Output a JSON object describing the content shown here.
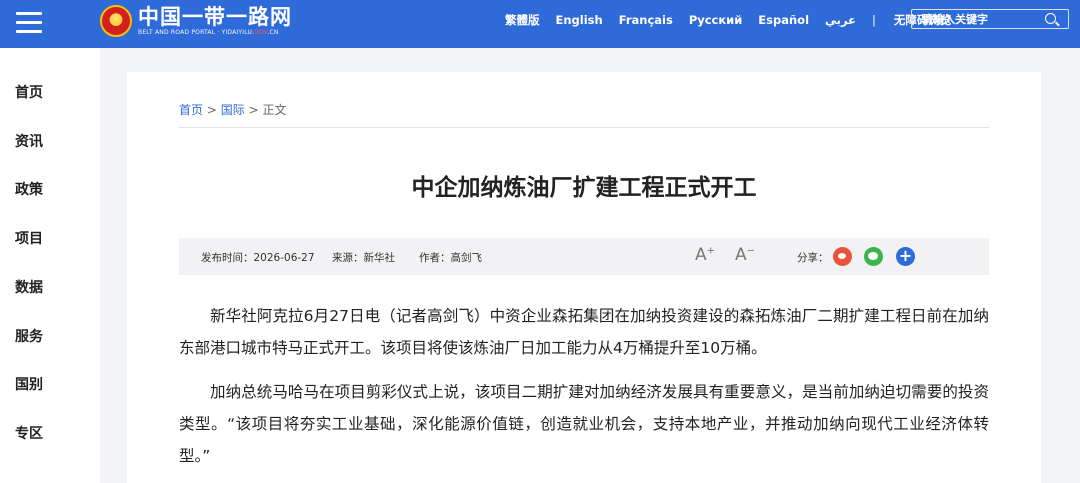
{
  "header": {
    "logo_cn": "中国一带一路网",
    "logo_en_prefix": "BELT AND ROAD PORTAL · YIDAIYILU.",
    "logo_en_gov": "GOV",
    "logo_en_suffix": ".CN",
    "langs": [
      "繁體版",
      "English",
      "Français",
      "Русский",
      "Español",
      "عربي"
    ],
    "separator": "|",
    "accessibility": "无障碍浏览",
    "search_placeholder": "请输入关键字",
    "bg_color": "#2f6bd8"
  },
  "sidebar": {
    "items": [
      "首页",
      "资讯",
      "政策",
      "项目",
      "数据",
      "服务",
      "国别",
      "专区"
    ]
  },
  "breadcrumb": {
    "home": "首页",
    "sep1": ">",
    "section": "国际",
    "sep2": ">",
    "current": "正文"
  },
  "article": {
    "title": "中企加纳炼油厂扩建工程正式开工",
    "publish_time": "发布时间：2026-06-27",
    "source": "来源：新华社",
    "author": "作者：高剑飞",
    "font_increase": "A",
    "font_increase_sup": "+",
    "font_decrease": "A",
    "font_decrease_sup": "−",
    "share_label": "分享：",
    "share_more": "+",
    "paragraphs": [
      "新华社阿克拉6月27日电（记者高剑飞）中资企业森拓集团在加纳投资建设的森拓炼油厂二期扩建工程日前在加纳东部港口城市特马正式开工。该项目将使该炼油厂日加工能力从4万桶提升至10万桶。",
      "加纳总统马哈马在项目剪彩仪式上说，该项目二期扩建对加纳经济发展具有重要意义，是当前加纳迫切需要的投资类型。“该项目将夯实工业基础，深化能源价值链，创造就业机会，支持本地产业，并推动加纳向现代工业经济体转型。”"
    ]
  }
}
